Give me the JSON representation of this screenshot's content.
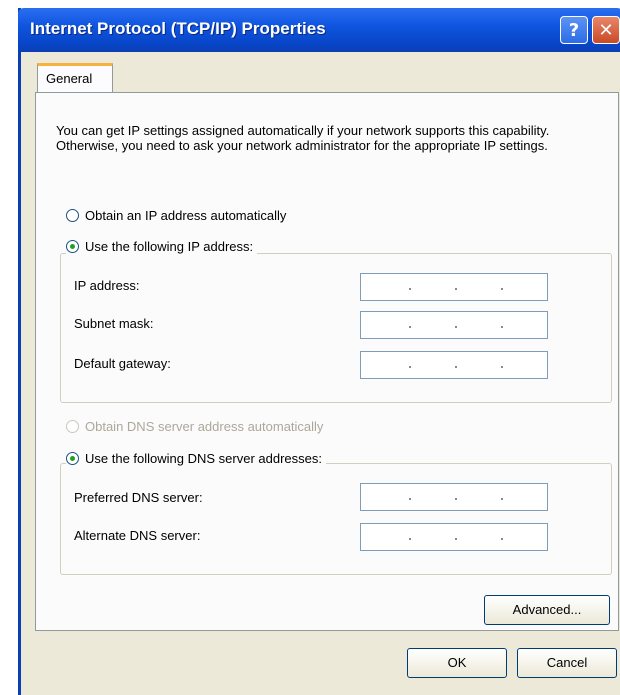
{
  "window": {
    "title": "Internet Protocol (TCP/IP) Properties",
    "help_label": "?",
    "close_label": "✕"
  },
  "tabs": [
    {
      "label": "General",
      "active": true
    }
  ],
  "description": "You can get IP settings assigned automatically if your network supports this capability. Otherwise, you need to ask your network administrator for the appropriate IP settings.",
  "ip_mode": {
    "auto_label": "Obtain an IP address automatically",
    "manual_label": "Use the following IP address:",
    "selected": "manual"
  },
  "ip_fields": [
    {
      "label": "IP address:",
      "value": ""
    },
    {
      "label": "Subnet mask:",
      "value": ""
    },
    {
      "label": "Default gateway:",
      "value": ""
    }
  ],
  "dns_mode": {
    "auto_label": "Obtain DNS server address automatically",
    "manual_label": "Use the following DNS server addresses:",
    "selected": "manual",
    "auto_disabled": true
  },
  "dns_fields": [
    {
      "label": "Preferred DNS server:",
      "value": ""
    },
    {
      "label": "Alternate DNS server:",
      "value": ""
    }
  ],
  "buttons": {
    "advanced": "Advanced...",
    "ok": "OK",
    "cancel": "Cancel"
  },
  "colors": {
    "titlebar": "#0a47d0",
    "tab_accent": "#f7b33e",
    "radio_selected": "#21a121"
  }
}
